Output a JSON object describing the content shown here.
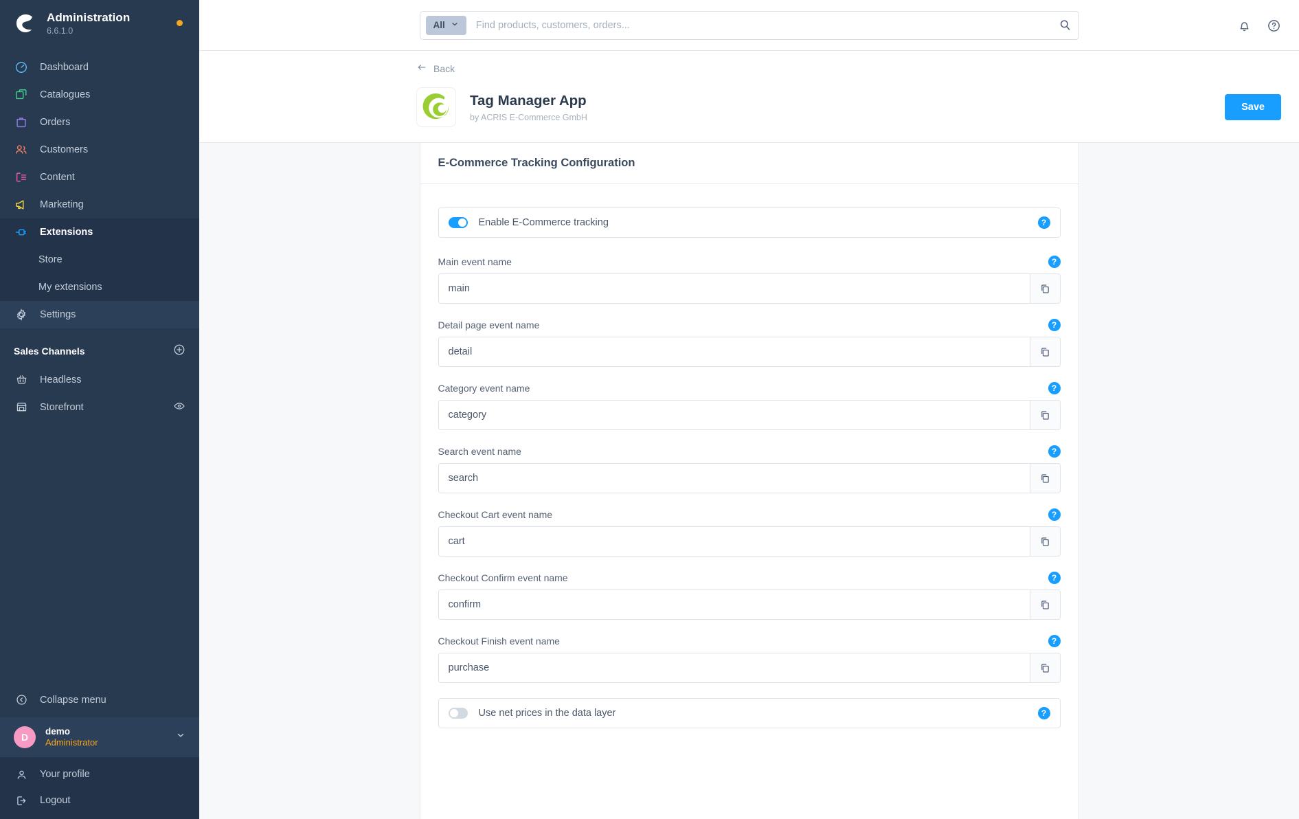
{
  "sidebar": {
    "brand": {
      "title": "Administration",
      "version": "6.6.1.0",
      "logo_icon": "shopware-logo-icon",
      "status_dot": "update-available-dot"
    },
    "nav": [
      {
        "label": "Dashboard",
        "icon": "dashboard-icon",
        "color": "#5bb9f5"
      },
      {
        "label": "Catalogues",
        "icon": "catalogues-icon",
        "color": "#3ecf8e"
      },
      {
        "label": "Orders",
        "icon": "orders-icon",
        "color": "#8f7ce6"
      },
      {
        "label": "Customers",
        "icon": "customers-icon",
        "color": "#ef7b61"
      },
      {
        "label": "Content",
        "icon": "content-icon",
        "color": "#e95ca0"
      },
      {
        "label": "Marketing",
        "icon": "marketing-icon",
        "color": "#f2d541"
      }
    ],
    "extensions": {
      "label": "Extensions",
      "icon": "extensions-plug-icon",
      "color": "#189eff",
      "children": [
        {
          "label": "Store"
        },
        {
          "label": "My extensions"
        }
      ]
    },
    "settings": {
      "label": "Settings",
      "icon": "gear-icon"
    },
    "sales_channels": {
      "title": "Sales Channels",
      "add_icon": "plus-circle-icon",
      "items": [
        {
          "label": "Headless",
          "icon": "basket-icon",
          "trailing_icon": ""
        },
        {
          "label": "Storefront",
          "icon": "storefront-icon",
          "trailing_icon": "eye-icon"
        }
      ]
    },
    "collapse": {
      "label": "Collapse menu",
      "icon": "chevron-left-circle-icon"
    },
    "user": {
      "avatar_letter": "D",
      "name": "demo",
      "role": "Administrator",
      "chevron_icon": "chevron-down-icon"
    },
    "footer_links": [
      {
        "label": "Your profile",
        "icon": "user-icon"
      },
      {
        "label": "Logout",
        "icon": "logout-icon"
      }
    ]
  },
  "topbar": {
    "search": {
      "scope_label": "All",
      "scope_chevron": "chevron-down-icon",
      "placeholder": "Find products, customers, orders...",
      "value": "",
      "search_icon": "search-icon"
    },
    "notifications_icon": "bell-icon",
    "help_icon": "question-circle-icon"
  },
  "apphead": {
    "back_label": "Back",
    "back_icon": "arrow-left-icon",
    "app_logo_icon": "acris-logo-icon",
    "app_name": "Tag Manager App",
    "app_author": "by ACRIS E-Commerce GmbH",
    "save_label": "Save"
  },
  "card": {
    "title": "E-Commerce Tracking Configuration",
    "enable_toggle": {
      "label": "Enable E-Commerce tracking",
      "state": "on",
      "help_icon": "help-badge-icon"
    },
    "fields": [
      {
        "label": "Main event name",
        "value": "main",
        "copy_icon": "copy-icon",
        "help_icon": "help-badge-icon"
      },
      {
        "label": "Detail page event name",
        "value": "detail",
        "copy_icon": "copy-icon",
        "help_icon": "help-badge-icon"
      },
      {
        "label": "Category event name",
        "value": "category",
        "copy_icon": "copy-icon",
        "help_icon": "help-badge-icon"
      },
      {
        "label": "Search event name",
        "value": "search",
        "copy_icon": "copy-icon",
        "help_icon": "help-badge-icon"
      },
      {
        "label": "Checkout Cart event name",
        "value": "cart",
        "copy_icon": "copy-icon",
        "help_icon": "help-badge-icon"
      },
      {
        "label": "Checkout Confirm event name",
        "value": "confirm",
        "copy_icon": "copy-icon",
        "help_icon": "help-badge-icon"
      },
      {
        "label": "Checkout Finish event name",
        "value": "purchase",
        "copy_icon": "copy-icon",
        "help_icon": "help-badge-icon"
      }
    ],
    "netprices_toggle": {
      "label": "Use net prices in the data layer",
      "state": "off",
      "help_icon": "help-badge-icon"
    }
  },
  "colors": {
    "accent": "#189eff",
    "sidebar_bg": "#283a50",
    "sidebar_active": "#22334a",
    "brand_orange": "#f5a623",
    "avatar_pink": "#f89bc4",
    "app_logo_green": "#9acd32"
  }
}
